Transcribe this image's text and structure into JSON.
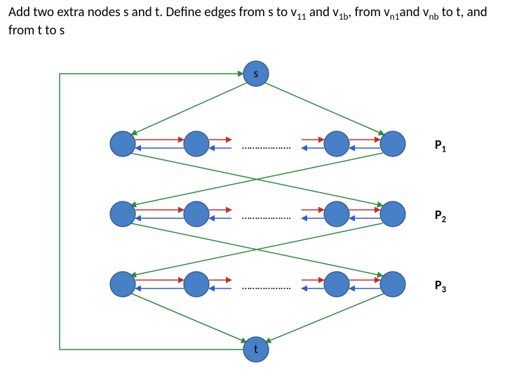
{
  "title_html": "Add two extra nodes s and t. Define edges from s to v<sub>11</sub> and v<sub>1b</sub>, from v<sub>n1</sub>and v<sub>nb</sub> to t, and from t to s",
  "nodes": {
    "s_label": "s",
    "t_label": "t"
  },
  "dots": "……………….",
  "row_labels": {
    "p1": "P<sub>1</sub>",
    "p2": "P<sub>2</sub>",
    "p3": "P<sub>3</sub>"
  },
  "colors": {
    "node_fill": "#4880c8",
    "node_stroke": "#33527f",
    "edge_green": "#2e8b3d",
    "edge_red": "#c0302c",
    "edge_blue": "#2f5fd0"
  },
  "chart_data": {
    "type": "diagram",
    "title": "Cycle-cover graph with extra s and t nodes",
    "rows": [
      "P1",
      "P2",
      "P3"
    ],
    "columns_per_row": "b (ellipsis after 2nd column, at least 4 shown)",
    "special_nodes": [
      "s (top)",
      "t (bottom)"
    ],
    "edge_sets": [
      {
        "name": "forward within row (red)",
        "pattern": "v[i,j] → v[i,j+1]"
      },
      {
        "name": "backward within row (blue)",
        "pattern": "v[i,j+1] → v[i,j]"
      },
      {
        "name": "diagonal green",
        "pattern": "row-to-row crossings"
      },
      {
        "name": "s out-edges",
        "pattern": "s → v11, s → v1b"
      },
      {
        "name": "t in-edges",
        "pattern": "vn1 → t, vnb → t"
      },
      {
        "name": "t → s",
        "pattern": "single back-edge routed along left margin"
      }
    ]
  }
}
